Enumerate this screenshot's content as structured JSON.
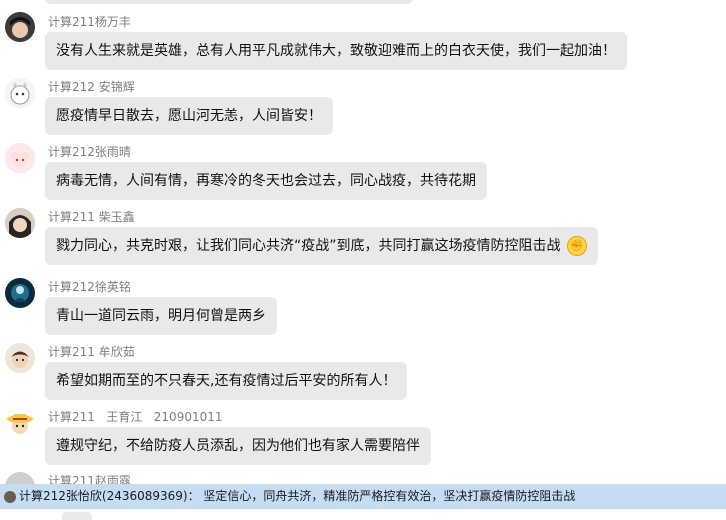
{
  "messages": [
    {
      "avatar": "avatar-dark-hair",
      "name": "计算211杨万丰",
      "text": "没有人生来就是英雄，总有人用平凡成就伟大，致敬迎难而上的白衣天使，我们一起加油！"
    },
    {
      "avatar": "avatar-white-cat",
      "name": "计算212 安锦辉",
      "text": "愿疫情早日散去，愿山河无恙，人间皆安！"
    },
    {
      "avatar": "avatar-pink-anime",
      "name": "计算212张雨晴",
      "text": "病毒无情，人间有情，再寒冷的冬天也会过去，同心战疫，共待花期"
    },
    {
      "avatar": "avatar-girl-photo",
      "name": "计算211 柴玉鑫",
      "text": "戮力同心，共克时艰，让我们同心共济“疫战”到底，共同打赢这场疫情防控阻击战",
      "emoji": "fist-emoji"
    },
    {
      "avatar": "avatar-blue-night",
      "name": "计算212徐英铭",
      "text": "青山一道同云雨，明月何曾是两乡"
    },
    {
      "avatar": "avatar-cartoon-boy",
      "name": "计算211 牟欣茹",
      "text": "希望如期而至的不只春天,还有疫情过后平安的所有人！"
    },
    {
      "avatar": "avatar-straw-hat",
      "name": "计算211   王育江   210901011",
      "text": "遵规守纪，不给防疫人员添乱，因为他们也有家人需要陪伴"
    },
    {
      "avatar": "avatar-partial",
      "name": "计算211赵雨露"
    }
  ],
  "banner": {
    "text": "计算212张怡欣(2436089369)：  坚定信心，同舟共济，精准防严格控有效治，坚决打赢疫情防控阻击战"
  },
  "colors": {
    "bubble": "#e9e9e9",
    "banner": "#c6dcf3",
    "name": "#7f7f7f"
  }
}
